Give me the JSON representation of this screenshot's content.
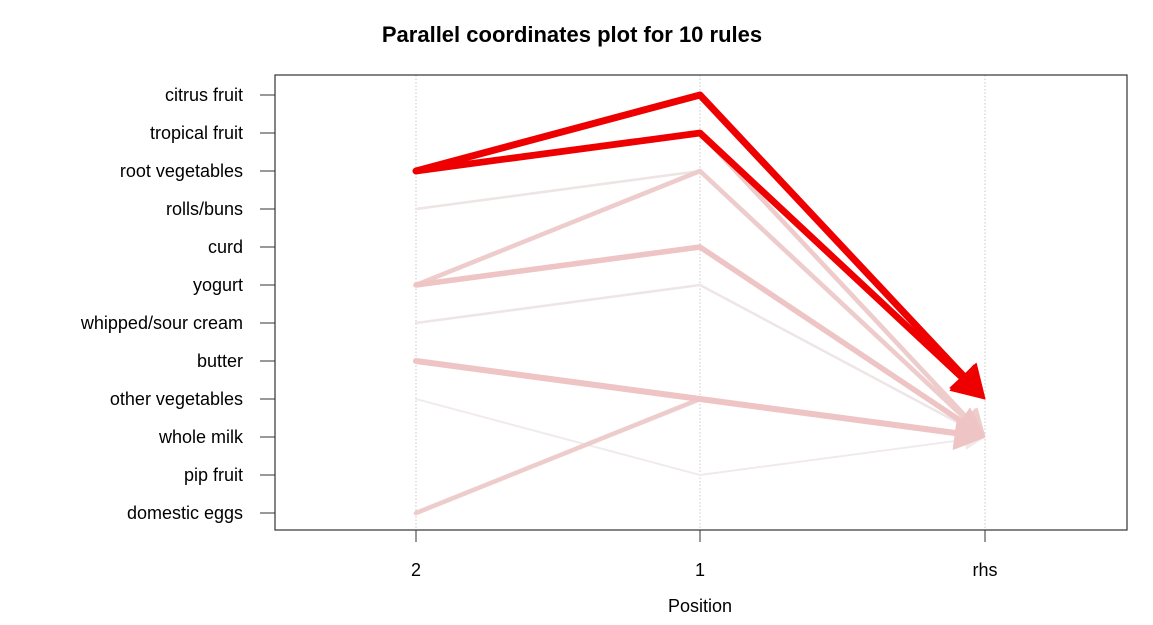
{
  "chart_data": {
    "type": "parallel-coordinates",
    "title": "Parallel coordinates plot for 10 rules",
    "xlabel": "Position",
    "ylabel": "",
    "x_categories": [
      "2",
      "1",
      "rhs"
    ],
    "y_categories": [
      "citrus fruit",
      "tropical fruit",
      "root vegetables",
      "rolls/buns",
      "curd",
      "yogurt",
      "whipped/sour cream",
      "butter",
      "other vegetables",
      "whole milk",
      "pip fruit",
      "domestic eggs"
    ],
    "grid": "vertical dotted at each position",
    "legend": "none",
    "encoding": "line width = support, color intensity = lift",
    "rules": [
      {
        "lhs": [
          "root vegetables",
          "citrus fruit"
        ],
        "rhs": "other vegetables",
        "color": "#EE0000",
        "weight": 1.0,
        "intensity": 1.0
      },
      {
        "lhs": [
          "root vegetables",
          "tropical fruit"
        ],
        "rhs": "other vegetables",
        "color": "#EE0000",
        "weight": 0.95,
        "intensity": 1.0
      },
      {
        "lhs": [
          "root vegetables",
          "tropical fruit"
        ],
        "rhs": "whole milk",
        "color": "#EECCCC",
        "weight": 0.6,
        "intensity": 0.3
      },
      {
        "lhs": [
          "rolls/buns",
          "root vegetables"
        ],
        "rhs": "whole milk",
        "color": "#EEE4E4",
        "weight": 0.25,
        "intensity": 0.1
      },
      {
        "lhs": [
          "yogurt",
          "root vegetables"
        ],
        "rhs": "whole milk",
        "color": "#EECCCC",
        "weight": 0.6,
        "intensity": 0.3
      },
      {
        "lhs": [
          "yogurt",
          "curd"
        ],
        "rhs": "whole milk",
        "color": "#EEC4C4",
        "weight": 0.75,
        "intensity": 0.35
      },
      {
        "lhs": [
          "whipped/sour cream",
          "yogurt"
        ],
        "rhs": "whole milk",
        "color": "#EEE6E6",
        "weight": 0.25,
        "intensity": 0.08
      },
      {
        "lhs": [
          "butter",
          "other vegetables"
        ],
        "rhs": "whole milk",
        "color": "#EEC4C4",
        "weight": 0.85,
        "intensity": 0.35
      },
      {
        "lhs": [
          "domestic eggs",
          "other vegetables"
        ],
        "rhs": "whole milk",
        "color": "#EECCCC",
        "weight": 0.6,
        "intensity": 0.3
      },
      {
        "lhs": [
          "other vegetables",
          "pip fruit"
        ],
        "rhs": "whole milk",
        "color": "#F0EAEA",
        "weight": 0.15,
        "intensity": 0.05
      }
    ]
  }
}
